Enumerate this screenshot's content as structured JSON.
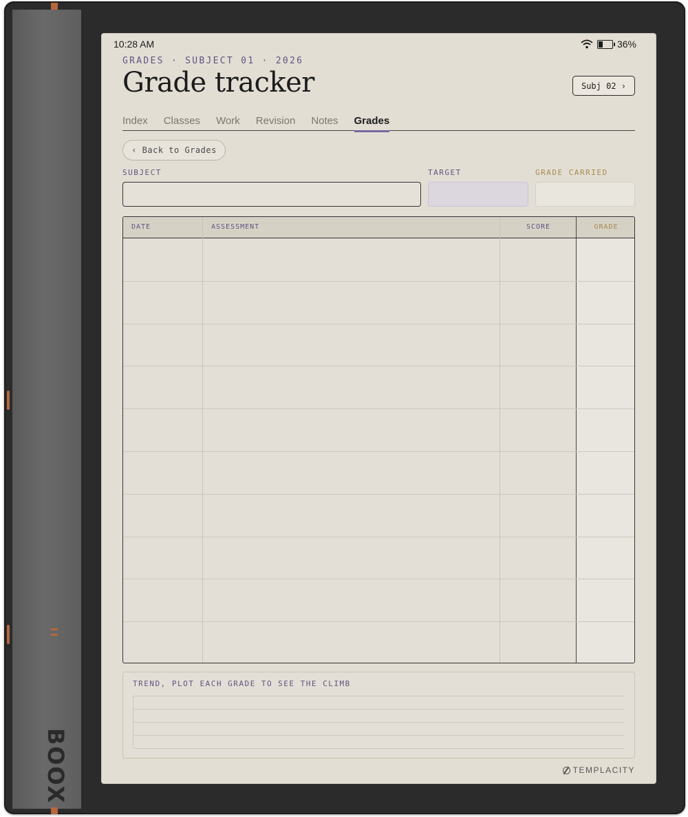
{
  "device": {
    "brand": "BOOX"
  },
  "status": {
    "time": "10:28 AM",
    "battery": "36%",
    "battery_level": 0.36
  },
  "header": {
    "eyebrow": "GRADES · SUBJECT 01 · 2026",
    "title": "Grade tracker",
    "next_subject_label": "Subj 02 ›"
  },
  "tabs": [
    {
      "label": "Index",
      "active": false
    },
    {
      "label": "Classes",
      "active": false
    },
    {
      "label": "Work",
      "active": false
    },
    {
      "label": "Revision",
      "active": false
    },
    {
      "label": "Notes",
      "active": false
    },
    {
      "label": "Grades",
      "active": true
    }
  ],
  "back_button": "‹ Back to Grades",
  "fields": {
    "subject_label": "SUBJECT",
    "subject_value": "",
    "target_label": "TARGET",
    "target_value": "",
    "carried_label": "GRADE CARRIED",
    "carried_value": ""
  },
  "table": {
    "headers": {
      "date": "DATE",
      "assessment": "ASSESSMENT",
      "score": "SCORE",
      "grade": "GRADE"
    },
    "rows": [
      {
        "date": "",
        "assessment": "",
        "score": "",
        "grade": ""
      },
      {
        "date": "",
        "assessment": "",
        "score": "",
        "grade": ""
      },
      {
        "date": "",
        "assessment": "",
        "score": "",
        "grade": ""
      },
      {
        "date": "",
        "assessment": "",
        "score": "",
        "grade": ""
      },
      {
        "date": "",
        "assessment": "",
        "score": "",
        "grade": ""
      },
      {
        "date": "",
        "assessment": "",
        "score": "",
        "grade": ""
      },
      {
        "date": "",
        "assessment": "",
        "score": "",
        "grade": ""
      },
      {
        "date": "",
        "assessment": "",
        "score": "",
        "grade": ""
      },
      {
        "date": "",
        "assessment": "",
        "score": "",
        "grade": ""
      },
      {
        "date": "",
        "assessment": "",
        "score": "",
        "grade": ""
      }
    ]
  },
  "trend": {
    "label": "TREND, PLOT EACH GRADE TO SEE THE CLIMB"
  },
  "footer": {
    "brand": "TEMPLACITY"
  },
  "colors": {
    "accent": "#5e5480",
    "gold": "#a98a4e",
    "paper": "#e3ded4",
    "ink": "#1c1c1c"
  }
}
